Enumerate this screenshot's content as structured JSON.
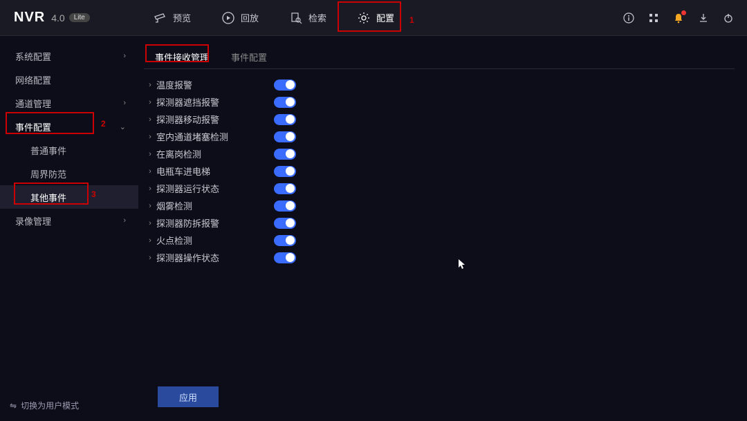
{
  "logo": {
    "brand": "NVR",
    "version": "4.0",
    "edition": "Lite"
  },
  "topnav": [
    {
      "label": "预览"
    },
    {
      "label": "回放"
    },
    {
      "label": "检索"
    },
    {
      "label": "配置",
      "active": true
    }
  ],
  "annotations": {
    "a1": "1",
    "a2": "2",
    "a3": "3"
  },
  "sidebar": {
    "items": [
      {
        "label": "系统配置",
        "expand": "›"
      },
      {
        "label": "网络配置"
      },
      {
        "label": "通道管理",
        "expand": "›"
      },
      {
        "label": "事件配置",
        "expand": "⌄",
        "active": true
      },
      {
        "label": "普通事件",
        "indent": true
      },
      {
        "label": "周界防范",
        "indent": true
      },
      {
        "label": "其他事件",
        "indent": true,
        "selected": true
      },
      {
        "label": "录像管理",
        "expand": "›"
      }
    ]
  },
  "tabs": [
    {
      "label": "事件接收管理",
      "active": true
    },
    {
      "label": "事件配置"
    }
  ],
  "rows": [
    {
      "label": "温度报警",
      "on": true
    },
    {
      "label": "探测器遮挡报警",
      "on": true
    },
    {
      "label": "探测器移动报警",
      "on": true
    },
    {
      "label": "室内通道堵塞检测",
      "on": true
    },
    {
      "label": "在离岗检测",
      "on": true
    },
    {
      "label": "电瓶车进电梯",
      "on": true
    },
    {
      "label": "探测器运行状态",
      "on": true
    },
    {
      "label": "烟雾检测",
      "on": true
    },
    {
      "label": "探测器防拆报警",
      "on": true
    },
    {
      "label": "火点检测",
      "on": true
    },
    {
      "label": "探测器操作状态",
      "on": true
    }
  ],
  "buttons": {
    "apply": "应用"
  },
  "footer": {
    "switch_mode": "切换为用户模式"
  }
}
